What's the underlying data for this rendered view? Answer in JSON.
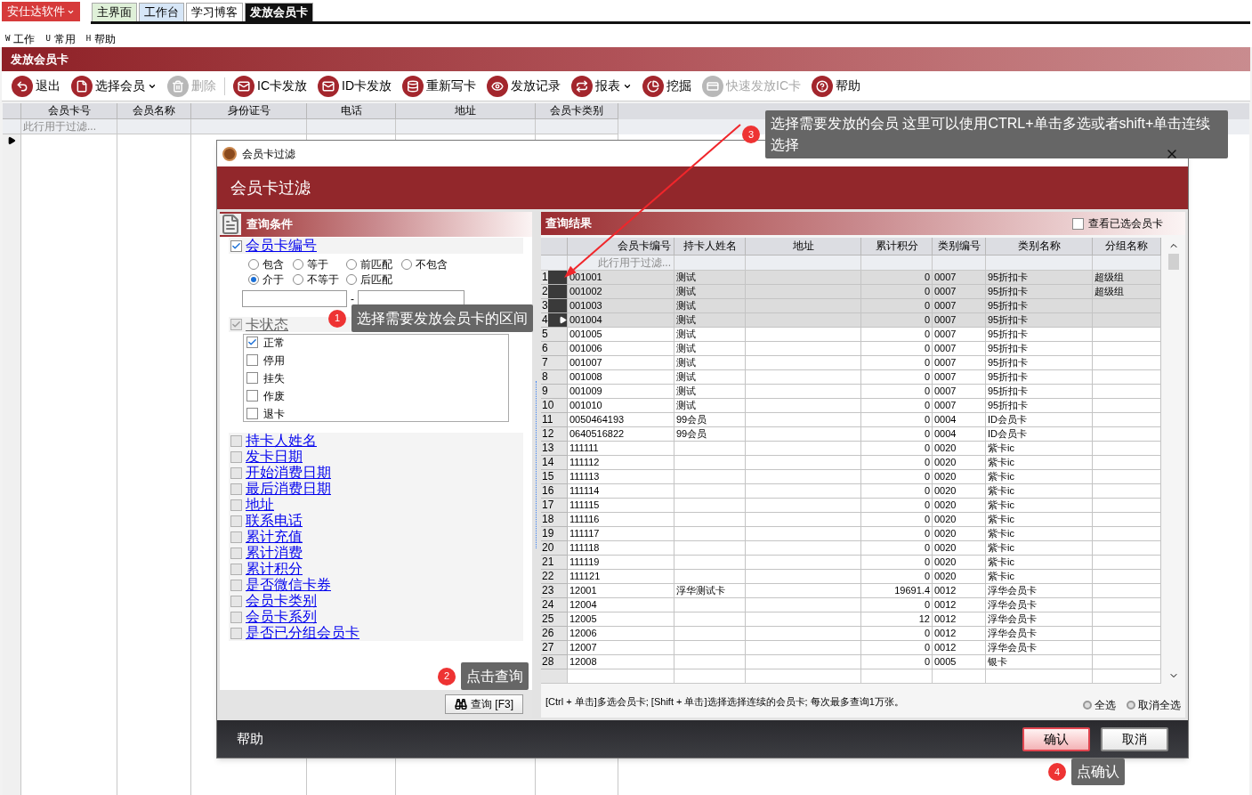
{
  "app_menu": {
    "label": "安仕达软件"
  },
  "tabs": [
    {
      "label": "主界面",
      "selected": false,
      "color": "#dff0d8"
    },
    {
      "label": "工作台",
      "selected": false,
      "color": "#d6e6f7"
    },
    {
      "label": "学习博客",
      "selected": false,
      "color": "#ffffff"
    },
    {
      "label": "发放会员卡",
      "selected": true,
      "color": "#111111"
    }
  ],
  "menu": [
    {
      "key": "W",
      "label": "工作"
    },
    {
      "key": "U",
      "label": "常用"
    },
    {
      "key": "H",
      "label": "帮助"
    }
  ],
  "page_title": "发放会员卡",
  "toolbar": [
    {
      "label": "退出",
      "kind": "back",
      "disabled": false,
      "dropdown": false
    },
    {
      "label": "选择会员",
      "kind": "document",
      "disabled": false,
      "dropdown": true
    },
    {
      "label": "删除",
      "kind": "trash",
      "disabled": true,
      "dropdown": false
    },
    {
      "label": "IC卡发放",
      "kind": "envelope",
      "disabled": false,
      "dropdown": false
    },
    {
      "label": "ID卡发放",
      "kind": "envelope",
      "disabled": false,
      "dropdown": false
    },
    {
      "label": "重新写卡",
      "kind": "database",
      "disabled": false,
      "dropdown": false
    },
    {
      "label": "发放记录",
      "kind": "eye",
      "disabled": false,
      "dropdown": false
    },
    {
      "label": "报表",
      "kind": "swap",
      "disabled": false,
      "dropdown": true
    },
    {
      "label": "挖掘",
      "kind": "pie",
      "disabled": false,
      "dropdown": false
    },
    {
      "label": "快速发放IC卡",
      "kind": "card",
      "disabled": true,
      "dropdown": false
    },
    {
      "label": "帮助",
      "kind": "help",
      "disabled": false,
      "dropdown": false
    }
  ],
  "main_grid": {
    "columns": [
      "会员卡号",
      "会员名称",
      "身份证号",
      "电话",
      "地址",
      "会员卡类别"
    ],
    "filter_placeholder": "此行用于过滤..."
  },
  "dialog": {
    "title": "会员卡过滤",
    "header": "会员卡过滤",
    "criteria": {
      "title": "查询条件",
      "card_number": {
        "label": "会员卡编号",
        "checked": true,
        "match_modes": [
          {
            "label": "包含",
            "selected": false
          },
          {
            "label": "等于",
            "selected": false
          },
          {
            "label": "前匹配",
            "selected": false
          },
          {
            "label": "不包含",
            "selected": false
          },
          {
            "label": "介于",
            "selected": true
          },
          {
            "label": "不等于",
            "selected": false
          },
          {
            "label": "后匹配",
            "selected": false
          }
        ],
        "range_separator": "-"
      },
      "card_status": {
        "label": "卡状态",
        "checked": true,
        "options": [
          {
            "label": "正常",
            "checked": true
          },
          {
            "label": "停用",
            "checked": false
          },
          {
            "label": "挂失",
            "checked": false
          },
          {
            "label": "作废",
            "checked": false
          },
          {
            "label": "退卡",
            "checked": false
          }
        ]
      },
      "other_fields": [
        {
          "label": "持卡人姓名",
          "checked": false
        },
        {
          "label": "发卡日期",
          "checked": false
        },
        {
          "label": "开始消费日期",
          "checked": false
        },
        {
          "label": "最后消费日期",
          "checked": false
        },
        {
          "label": "地址",
          "checked": false
        },
        {
          "label": "联系电话",
          "checked": false
        },
        {
          "label": "累计充值",
          "checked": false
        },
        {
          "label": "累计消费",
          "checked": false
        },
        {
          "label": "累计积分",
          "checked": false
        },
        {
          "label": "是否微信卡券",
          "checked": false
        },
        {
          "label": "会员卡类别",
          "checked": false
        },
        {
          "label": "会员卡系列",
          "checked": false
        },
        {
          "label": "是否已分组会员卡",
          "checked": false
        }
      ],
      "query_button": "查询 [F3]"
    },
    "results": {
      "title": "查询结果",
      "show_selected": {
        "label": "查看已选会员卡",
        "checked": false
      },
      "columns": [
        "会员卡编号",
        "持卡人姓名",
        "地址",
        "累计积分",
        "类别编号",
        "类别名称",
        "分组名称"
      ],
      "filter_placeholder": "此行用于过滤...",
      "rows": [
        {
          "number": "1",
          "card_no": "001001",
          "holder": "测试",
          "points": "0",
          "type_code": "0007",
          "type_name": "95折扣卡",
          "group": "超级组",
          "selected": true,
          "current": false
        },
        {
          "number": "2",
          "card_no": "001002",
          "holder": "测试",
          "points": "0",
          "type_code": "0007",
          "type_name": "95折扣卡",
          "group": "超级组",
          "selected": true,
          "current": false
        },
        {
          "number": "3",
          "card_no": "001003",
          "holder": "测试",
          "points": "0",
          "type_code": "0007",
          "type_name": "95折扣卡",
          "selected": true,
          "current": false
        },
        {
          "number": "4",
          "card_no": "001004",
          "holder": "测试",
          "points": "0",
          "type_code": "0007",
          "type_name": "95折扣卡",
          "selected": true,
          "current": true
        },
        {
          "number": "5",
          "card_no": "001005",
          "holder": "测试",
          "points": "0",
          "type_code": "0007",
          "type_name": "95折扣卡",
          "selected": false,
          "current": false
        },
        {
          "number": "6",
          "card_no": "001006",
          "holder": "测试",
          "points": "0",
          "type_code": "0007",
          "type_name": "95折扣卡",
          "selected": false,
          "current": false
        },
        {
          "number": "7",
          "card_no": "001007",
          "holder": "测试",
          "points": "0",
          "type_code": "0007",
          "type_name": "95折扣卡",
          "selected": false,
          "current": false
        },
        {
          "number": "8",
          "card_no": "001008",
          "holder": "测试",
          "points": "0",
          "type_code": "0007",
          "type_name": "95折扣卡",
          "selected": false,
          "current": false
        },
        {
          "number": "9",
          "card_no": "001009",
          "holder": "测试",
          "points": "0",
          "type_code": "0007",
          "type_name": "95折扣卡",
          "selected": false,
          "current": false
        },
        {
          "number": "10",
          "card_no": "001010",
          "holder": "测试",
          "points": "0",
          "type_code": "0007",
          "type_name": "95折扣卡",
          "selected": false,
          "current": false
        },
        {
          "number": "11",
          "card_no": "0050464193",
          "holder": "99会员",
          "points": "0",
          "type_code": "0004",
          "type_name": "ID会员卡",
          "selected": false,
          "current": false
        },
        {
          "number": "12",
          "card_no": "0640516822",
          "holder": "99会员",
          "points": "0",
          "type_code": "0004",
          "type_name": "ID会员卡",
          "selected": false,
          "current": false
        },
        {
          "number": "13",
          "card_no": "111111",
          "points": "0",
          "type_code": "0020",
          "type_name": "紫卡ic",
          "selected": false,
          "current": false
        },
        {
          "number": "14",
          "card_no": "111112",
          "points": "0",
          "type_code": "0020",
          "type_name": "紫卡ic",
          "selected": false,
          "current": false
        },
        {
          "number": "15",
          "card_no": "111113",
          "points": "0",
          "type_code": "0020",
          "type_name": "紫卡ic",
          "selected": false,
          "current": false
        },
        {
          "number": "16",
          "card_no": "111114",
          "points": "0",
          "type_code": "0020",
          "type_name": "紫卡ic",
          "selected": false,
          "current": false
        },
        {
          "number": "17",
          "card_no": "111115",
          "points": "0",
          "type_code": "0020",
          "type_name": "紫卡ic",
          "selected": false,
          "current": false
        },
        {
          "number": "18",
          "card_no": "111116",
          "points": "0",
          "type_code": "0020",
          "type_name": "紫卡ic",
          "selected": false,
          "current": false
        },
        {
          "number": "19",
          "card_no": "111117",
          "points": "0",
          "type_code": "0020",
          "type_name": "紫卡ic",
          "selected": false,
          "current": false
        },
        {
          "number": "20",
          "card_no": "111118",
          "points": "0",
          "type_code": "0020",
          "type_name": "紫卡ic",
          "selected": false,
          "current": false
        },
        {
          "number": "21",
          "card_no": "111119",
          "points": "0",
          "type_code": "0020",
          "type_name": "紫卡ic",
          "selected": false,
          "current": false
        },
        {
          "number": "22",
          "card_no": "111121",
          "points": "0",
          "type_code": "0020",
          "type_name": "紫卡ic",
          "selected": false,
          "current": false
        },
        {
          "number": "23",
          "card_no": "12001",
          "holder": "浮华测试卡",
          "points": "19691.4",
          "type_code": "0012",
          "type_name": "浮华会员卡",
          "selected": false,
          "current": false
        },
        {
          "number": "24",
          "card_no": "12004",
          "points": "0",
          "type_code": "0012",
          "type_name": "浮华会员卡",
          "selected": false,
          "current": false
        },
        {
          "number": "25",
          "card_no": "12005",
          "points": "12",
          "type_code": "0012",
          "type_name": "浮华会员卡",
          "selected": false,
          "current": false
        },
        {
          "number": "26",
          "card_no": "12006",
          "points": "0",
          "type_code": "0012",
          "type_name": "浮华会员卡",
          "selected": false,
          "current": false
        },
        {
          "number": "27",
          "card_no": "12007",
          "points": "0",
          "type_code": "0012",
          "type_name": "浮华会员卡",
          "selected": false,
          "current": false
        },
        {
          "number": "28",
          "card_no": "12008",
          "points": "0",
          "type_code": "0005",
          "type_name": "银卡",
          "selected": false,
          "current": false
        }
      ],
      "hint": "[Ctrl + 单击]多选会员卡; [Shift + 单击]选择选择连续的会员卡; 每次最多查询1万张。",
      "select_all": "全选",
      "deselect_all": "取消全选"
    },
    "footer": {
      "help": "帮助",
      "buttons": [
        {
          "label": "确认",
          "kind": "primary"
        },
        {
          "label": "取消",
          "kind": "normal"
        }
      ]
    }
  },
  "callouts": [
    {
      "number": "3",
      "text": "选择需要发放的会员 这里可以使用CTRL+单击多选或者shift+单击连续选择"
    },
    {
      "number": "1",
      "text": "选择需要发放会员卡的区间"
    },
    {
      "number": "2",
      "text": "点击查询"
    },
    {
      "number": "4",
      "text": "点确认"
    }
  ]
}
